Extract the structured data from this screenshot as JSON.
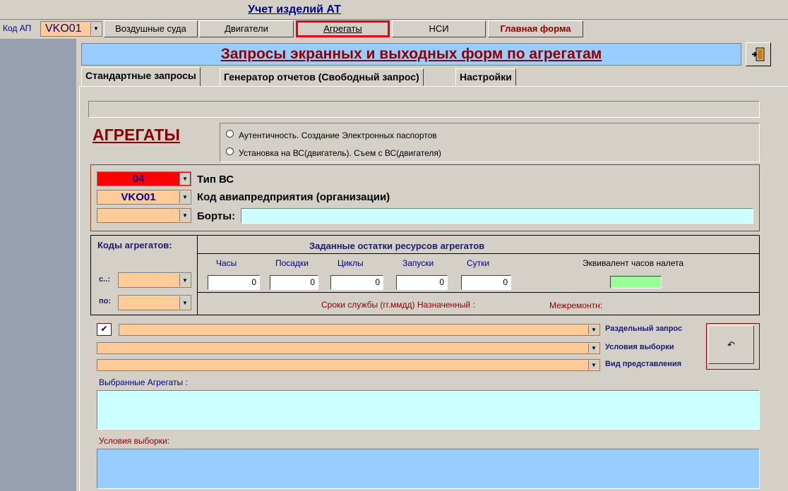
{
  "app": {
    "title": "Учет изделий АТ"
  },
  "topbar": {
    "code_ap_label": "Код АП",
    "code_ap_value": "VKO01"
  },
  "nav": {
    "aircraft": "Воздушные суда",
    "engines": "Двигатели",
    "aggregates": "Агрегаты",
    "nsi": "НСИ",
    "main_form": "Главная форма"
  },
  "form": {
    "title": "Запросы экранных и выходных форм по агрегатам"
  },
  "tabs": {
    "standard": "Стандартные запросы",
    "generator": "Генератор отчетов (Свободный запрос)",
    "settings": "Настройки"
  },
  "section": {
    "heading": "АГРЕГАТЫ",
    "radio1": "Аутентичность. Создание Электронных паспортов",
    "radio2": "Установка на ВС(двигатель).  Съем с ВС(двигателя)"
  },
  "filters": {
    "type_value": "04",
    "type_label": "Тип ВС",
    "org_value": "VKO01",
    "org_label": "Код авиапредприятия (организации)",
    "boards_label": "Борты:"
  },
  "codes": {
    "title": "Коды агрегатов:",
    "from_label": "с..:",
    "to_label": "по:"
  },
  "resources": {
    "title": "Заданные остатки ресурсов агрегатов",
    "hours_label": "Часы",
    "landings_label": "Посадки",
    "cycles_label": "Циклы",
    "starts_label": "Запуски",
    "days_label": "Сутки",
    "equiv_label": "Эквивалент часов налета",
    "hours": "0",
    "landings": "0",
    "cycles": "0",
    "starts": "0",
    "days": "0",
    "service_life_label": "Сроки службы (гг.ммдд) Назначенный :",
    "overhaul_label": "Межремонтн:"
  },
  "query": {
    "separate_label": "Раздельный запрос",
    "conditions_label": "Условия выборки",
    "view_label": "Вид представления",
    "selected_label": "Выбранные Агрегаты :",
    "conditions_area_label": "Условия выборки:",
    "separate_checked": true
  },
  "colors": {
    "accent_red": "#8b0000",
    "peach": "#ffcc99",
    "light_blue": "#99ccff",
    "cyan": "#ccffff",
    "green": "#99ff99"
  }
}
